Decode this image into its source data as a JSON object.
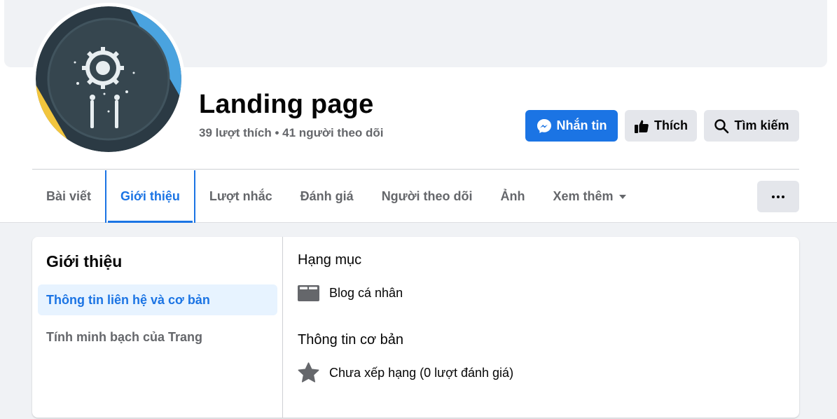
{
  "page": {
    "name": "Landing page",
    "likes_text": "39 lượt thích",
    "separator": "•",
    "followers_text": "41 người theo dõi"
  },
  "actions": {
    "message_label": "Nhắn tin",
    "like_label": "Thích",
    "search_label": "Tìm kiếm"
  },
  "tabs": [
    {
      "label": "Bài viết",
      "active": false
    },
    {
      "label": "Giới thiệu",
      "active": true
    },
    {
      "label": "Lượt nhắc",
      "active": false
    },
    {
      "label": "Đánh giá",
      "active": false
    },
    {
      "label": "Người theo dõi",
      "active": false
    },
    {
      "label": "Ảnh",
      "active": false
    },
    {
      "label": "Xem thêm",
      "active": false
    }
  ],
  "about": {
    "title": "Giới thiệu",
    "side_items": [
      {
        "label": "Thông tin liên hệ và cơ bản",
        "active": true
      },
      {
        "label": "Tính minh bạch của Trang",
        "active": false
      }
    ],
    "category_title": "Hạng mục",
    "category_value": "Blog cá nhân",
    "basic_title": "Thông tin cơ bản",
    "rating_value": "Chưa xếp hạng (0 lượt đánh giá)"
  },
  "icons": {
    "message": "messenger-icon",
    "like": "thumbs-up-icon",
    "search": "search-icon",
    "more": "more-dots-icon",
    "dropdown": "caret-down-icon",
    "category": "folder-icon",
    "rating": "star-icon"
  },
  "colors": {
    "accent": "#1b74e4",
    "background": "#f0f2f5",
    "secondary_text": "#65676b",
    "button_grey": "#e4e6eb",
    "active_tab_bg": "#e7f3ff"
  }
}
